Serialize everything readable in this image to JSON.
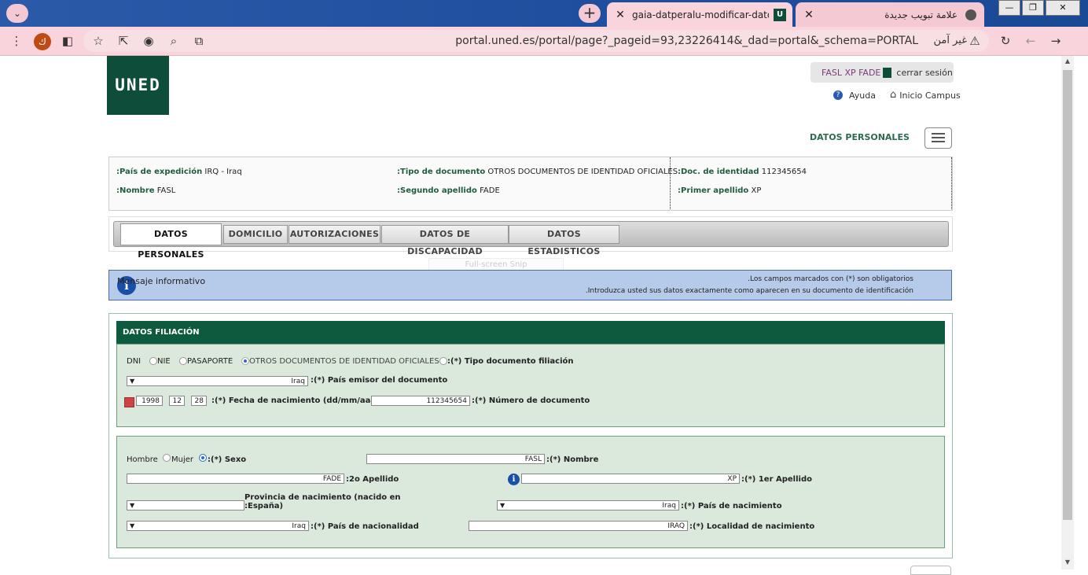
{
  "browser": {
    "active_tab_title": "gaia-datperalu-modificar-datosp",
    "inactive_tab_title": "علامة تبويب جديدة",
    "url": "portal.uned.es/portal/page?_pageid=93,23226414&_dad=portal&_schema=PORTAL",
    "security_text": "غير آمن",
    "avatar_letter": "ك",
    "favicon_letter": "U"
  },
  "header": {
    "logo_text": "UNED",
    "user_name": "FASL XP FADE",
    "logout_label": "cerrar sesión",
    "help_label": "Ayuda",
    "home_label": "Inicio Campus",
    "section_title": "DATOS PERSONALES"
  },
  "summary": {
    "pais_expedicion_label": ":País de expedición",
    "pais_expedicion_value": "IRQ - Iraq",
    "tipo_documento_label": ":Tipo de documento",
    "tipo_documento_value": "OTROS DOCUMENTOS DE IDENTIDAD OFICIALES",
    "doc_identidad_label": ":Doc. de identidad",
    "doc_identidad_value": "112345654",
    "nombre_label": ":Nombre",
    "nombre_value": "FASL",
    "segundo_apellido_label": ":Segundo apellido",
    "segundo_apellido_value": "FADE",
    "primer_apellido_label": ":Primer apellido",
    "primer_apellido_value": "XP"
  },
  "tabs": [
    {
      "label": "DATOS PERSONALES"
    },
    {
      "label": "DOMICILIO"
    },
    {
      "label": "AUTORIZACIONES"
    },
    {
      "label": "DATOS DE DISCAPACIDAD"
    },
    {
      "label": "DATOS ESTADISTICOS"
    }
  ],
  "ghost_text": "Full-screen Snip",
  "info": {
    "title": "Mensaje informativo",
    "msg1": ".Los campos marcados con (*) son obligatorios",
    "msg2": ".Introduzca usted sus datos exactamente como aparecen en su documento de identificación"
  },
  "form": {
    "header": "DATOS FILIACIÓN",
    "doc_types": [
      "DNI",
      "NIE",
      "PASAPORTE",
      "OTROS DOCUMENTOS DE IDENTIDAD OFICIALES"
    ],
    "tipo_doc_label": ":(*) Tipo documento filiación",
    "pais_emisor_value": "Iraq",
    "pais_emisor_label": ":(*) País emisor del documento",
    "birth_year": "1998",
    "birth_month": "12",
    "birth_day": "28",
    "fecha_label": ":(*) Fecha de nacimiento (dd/mm/aaaa)",
    "num_doc_value": "112345654",
    "num_doc_label": ":(*) Número de documento",
    "sexo_options": [
      "Hombre",
      "Mujer"
    ],
    "sexo_label": ":(*) Sexo",
    "nombre_value": "FASL",
    "nombre_label": ":(*) Nombre",
    "apellido2_value": "FADE",
    "apellido2_label": ":2o Apellido",
    "apellido1_value": "XP",
    "apellido1_label": ":(*) 1er Apellido",
    "provincia_label_1": "Provincia de nacimiento (nacido en",
    "provincia_label_2": ":España)",
    "pais_nac_value": "Iraq",
    "pais_nac_label": ":(*) País de nacimiento",
    "nacionalidad_value": "Iraq",
    "nacionalidad_label": ":(*) País de nacionalidad",
    "localidad_value": "IRAQ",
    "localidad_label": ":(*) Localidad de nacimiento"
  }
}
